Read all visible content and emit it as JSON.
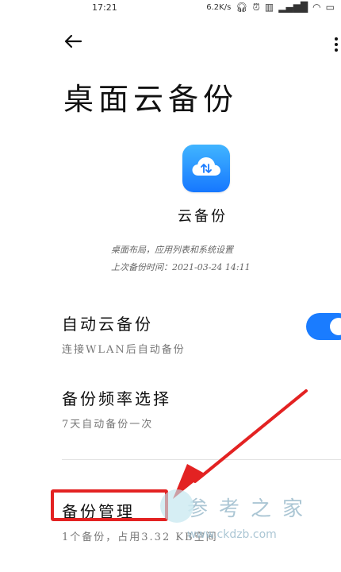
{
  "status_bar": {
    "time": "17:21",
    "speed": "6.2K/s",
    "icons": [
      "headset-icon",
      "alarm-icon",
      "hd-icon",
      "signal-icon",
      "wifi-icon",
      "battery-icon"
    ]
  },
  "header": {
    "back_icon": "arrow-left-icon",
    "more_icon": "more-vertical-icon",
    "title": "桌面云备份"
  },
  "app": {
    "icon": "cloud-sync-icon",
    "name": "云备份",
    "description_line1": "桌面布局，应用列表和系统设置",
    "description_line2": "上次备份时间：2021-03-24 14:11"
  },
  "settings": {
    "auto_backup": {
      "title": "自动云备份",
      "subtitle": "连接WLAN后自动备份",
      "toggle_on": true
    },
    "frequency": {
      "title": "备份频率选择",
      "subtitle": "7天自动备份一次"
    },
    "manage": {
      "title": "备份管理",
      "subtitle": "1个备份，占用3.32 KB空间"
    }
  },
  "watermark": {
    "chinese": "参考之家",
    "url": "www.ckdzb.com"
  },
  "colors": {
    "accent": "#1a7cff",
    "highlight": "#e32222"
  }
}
